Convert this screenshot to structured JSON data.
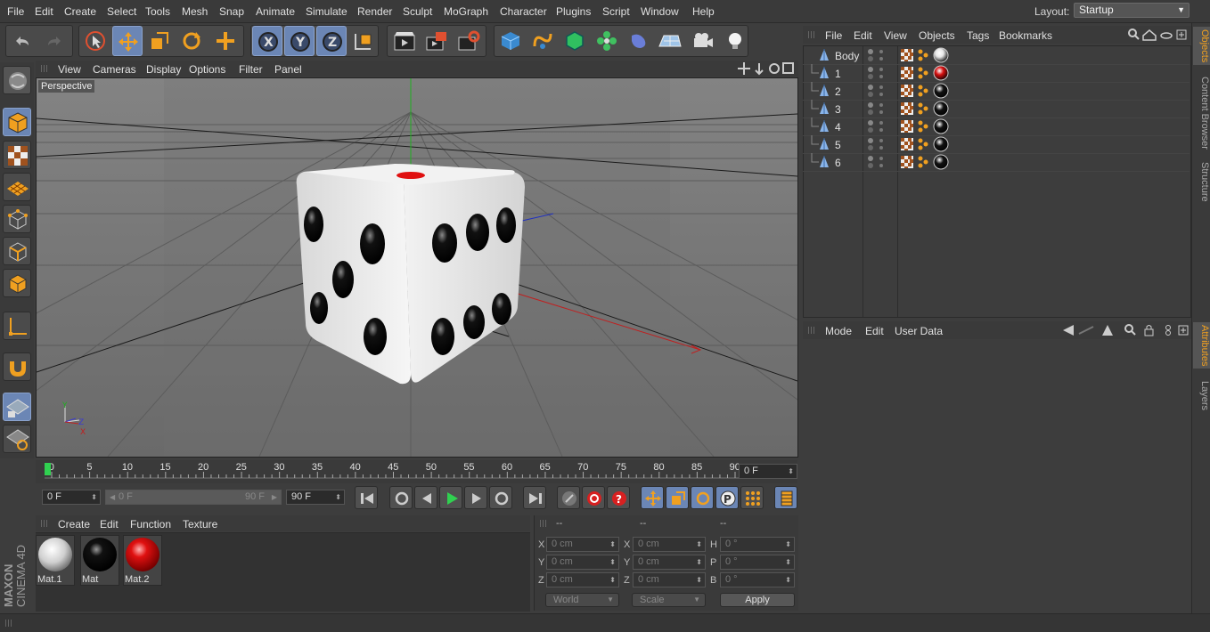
{
  "menubar": {
    "items": [
      "File",
      "Edit",
      "Create",
      "Select",
      "Tools",
      "Mesh",
      "Snap",
      "Animate",
      "Simulate",
      "Render",
      "Sculpt",
      "MoGraph",
      "Character",
      "Plugins",
      "Script",
      "Window",
      "Help"
    ],
    "layout_label": "Layout:",
    "layout_value": "Startup"
  },
  "toolbar": {
    "buttons": [
      "undo-icon",
      "redo-icon",
      "live-selection-icon",
      "move-icon",
      "scale-icon",
      "rotate-icon",
      "add-icon",
      "x-axis-icon",
      "y-axis-icon",
      "z-axis-icon",
      "coordinate-system-icon",
      "render-view-icon",
      "render-picture-viewer-icon",
      "render-settings-icon",
      "cube-icon",
      "spline-icon",
      "nurbs-icon",
      "array-icon",
      "deformer-icon",
      "floor-icon",
      "camera-icon",
      "light-icon"
    ]
  },
  "viewport": {
    "menu": [
      "View",
      "Cameras",
      "Display",
      "Options",
      "Filter",
      "Panel"
    ],
    "label": "Perspective"
  },
  "timeline": {
    "ticks": [
      "0",
      "5",
      "10",
      "15",
      "20",
      "25",
      "30",
      "35",
      "40",
      "45",
      "50",
      "55",
      "60",
      "65",
      "70",
      "75",
      "80",
      "85",
      "90"
    ],
    "current_frame": "0 F",
    "start_field": "0 F",
    "range_start": "0 F",
    "range_end": "90 F",
    "end_field": "90 F"
  },
  "materials": {
    "menu": [
      "Create",
      "Edit",
      "Function",
      "Texture"
    ],
    "items": [
      {
        "label": "Mat.1",
        "color": "#e8e8e8"
      },
      {
        "label": "Mat",
        "color": "#111111"
      },
      {
        "label": "Mat.2",
        "color": "#d81010"
      }
    ]
  },
  "coordinates": {
    "headers": [
      "--",
      "--",
      "--"
    ],
    "rows": [
      {
        "a": "X",
        "av": "0 cm",
        "b": "X",
        "bv": "0 cm",
        "c": "H",
        "cv": "0 °"
      },
      {
        "a": "Y",
        "av": "0 cm",
        "b": "Y",
        "bv": "0 cm",
        "c": "P",
        "cv": "0 °"
      },
      {
        "a": "Z",
        "av": "0 cm",
        "b": "Z",
        "bv": "0 cm",
        "c": "B",
        "cv": "0 °"
      }
    ],
    "world": "World",
    "scale": "Scale",
    "apply": "Apply"
  },
  "object_manager": {
    "menu": [
      "File",
      "Edit",
      "View",
      "Objects",
      "Tags",
      "Bookmarks"
    ],
    "objects": [
      {
        "name": "Body",
        "material": "#e8e8e8"
      },
      {
        "name": "1",
        "material": "#d81010"
      },
      {
        "name": "2",
        "material": "#111111"
      },
      {
        "name": "3",
        "material": "#111111"
      },
      {
        "name": "4",
        "material": "#111111"
      },
      {
        "name": "5",
        "material": "#111111"
      },
      {
        "name": "6",
        "material": "#111111"
      }
    ]
  },
  "attributes": {
    "menu": [
      "Mode",
      "Edit",
      "User Data"
    ]
  },
  "right_tabs": [
    "Objects",
    "Content Browser",
    "Structure",
    "Attributes",
    "Layers"
  ],
  "branding": {
    "line1": "MAXON",
    "line2": "CINEMA 4D"
  },
  "colors": {
    "accent": "#6b86b5",
    "panel": "#3d3d3d",
    "viewport": "#6a6a6a"
  }
}
